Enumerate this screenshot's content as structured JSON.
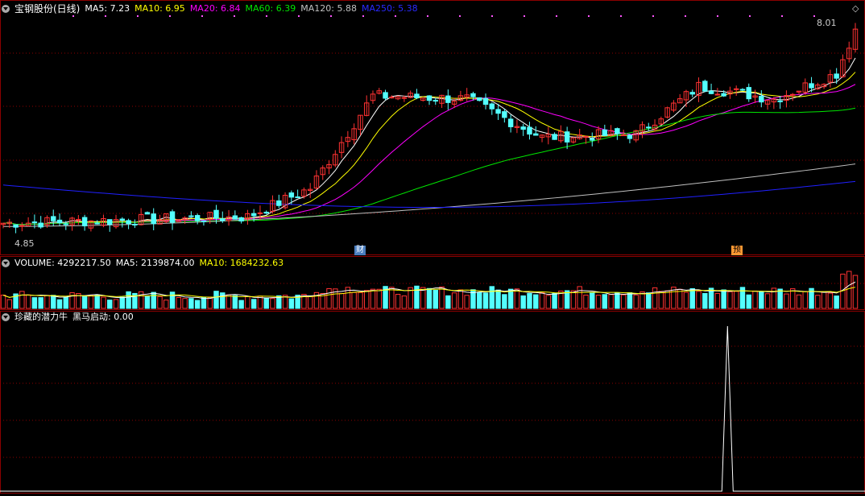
{
  "colors": {
    "up": "#ff3232",
    "down": "#54ffff",
    "ma5": "#ffffff",
    "ma10": "#ffff00",
    "ma20": "#ff00ff",
    "ma60": "#00e600",
    "ma120": "#c0c0c0",
    "ma250": "#2020ff",
    "grid": "#8b0000",
    "bg": "#000000"
  },
  "main": {
    "title": "宝钢股份(日线)",
    "ma5": "MA5: 7.23",
    "ma10": "MA10: 6.95",
    "ma20": "MA20: 6.84",
    "ma60": "MA60: 6.39",
    "ma120": "MA120: 5.88",
    "ma250": "MA250: 5.38",
    "high_label": "8.01",
    "low_label": "4.85",
    "tag_cai": "财",
    "tag_yu": "预"
  },
  "volume": {
    "title": "VOLUME: 4292217.50",
    "ma5": "MA5: 2139874.00",
    "ma10": "MA10: 1684232.63"
  },
  "indicator": {
    "title": "珍藏的潜力牛",
    "value": "黑马启动: 0.00"
  },
  "chart_data": [
    {
      "type": "candlestick",
      "title": "宝钢股份(日线)",
      "ylim": [
        4.6,
        8.2
      ],
      "annotations": {
        "high": 8.01,
        "low": 4.85
      },
      "segments": [
        {
          "count": 40,
          "start": 4.95,
          "end": 5.05
        },
        {
          "count": 10,
          "start": 5.05,
          "end": 5.5
        },
        {
          "count": 10,
          "start": 5.5,
          "end": 6.95
        },
        {
          "count": 15,
          "start": 6.95,
          "end": 6.9
        },
        {
          "count": 12,
          "start": 6.9,
          "end": 6.3
        },
        {
          "count": 15,
          "start": 6.3,
          "end": 6.35
        },
        {
          "count": 10,
          "start": 6.35,
          "end": 7.1
        },
        {
          "count": 12,
          "start": 7.1,
          "end": 6.9
        },
        {
          "count": 10,
          "start": 6.9,
          "end": 7.3
        },
        {
          "count": 3,
          "start": 7.3,
          "end": 8.0
        }
      ],
      "moving_averages": {
        "MA5": 7.23,
        "MA10": 6.95,
        "MA20": 6.84,
        "MA60": 6.39,
        "MA120": 5.88,
        "MA250": 5.38
      }
    },
    {
      "type": "bar",
      "title": "VOLUME",
      "last_value": 4292217.5,
      "ma5": 2139874.0,
      "ma10": 1684232.63
    },
    {
      "type": "line",
      "title": "珍藏的潜力牛",
      "series": [
        {
          "name": "黑马启动",
          "spike_at_fraction": 0.85,
          "spike_value": 1,
          "last_value": 0.0
        }
      ]
    }
  ]
}
